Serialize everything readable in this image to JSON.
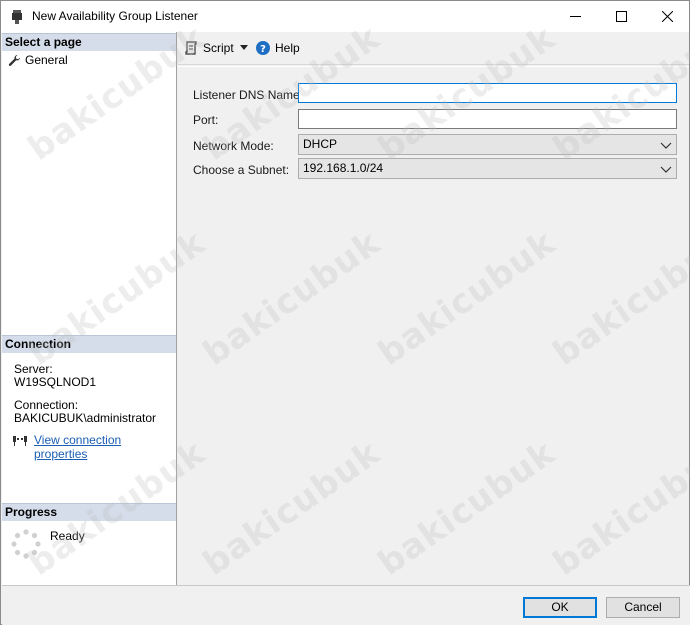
{
  "window": {
    "title": "New Availability Group Listener"
  },
  "sidebar": {
    "select_page_header": "Select a page",
    "pages": [
      {
        "label": "General"
      }
    ],
    "connection_header": "Connection",
    "server_label": "Server:",
    "server_value": "W19SQLNOD1",
    "connection_label": "Connection:",
    "connection_value": "BAKICUBUK\\administrator",
    "view_connection_link": "View connection properties",
    "progress_header": "Progress",
    "progress_status": "Ready"
  },
  "toolbar": {
    "script_label": "Script",
    "help_label": "Help"
  },
  "form": {
    "dns_label": "Listener DNS Name:",
    "dns_value": "",
    "port_label": "Port:",
    "port_value": "",
    "network_mode_label": "Network Mode:",
    "network_mode_value": "DHCP",
    "subnet_label": "Choose a Subnet:",
    "subnet_value": "192.168.1.0/24"
  },
  "footer": {
    "ok_label": "OK",
    "cancel_label": "Cancel"
  },
  "watermark_text": "bakicubuk",
  "colors": {
    "accent": "#0078d7",
    "section_header_bg": "#d4dde9",
    "link": "#1a5fb4"
  }
}
